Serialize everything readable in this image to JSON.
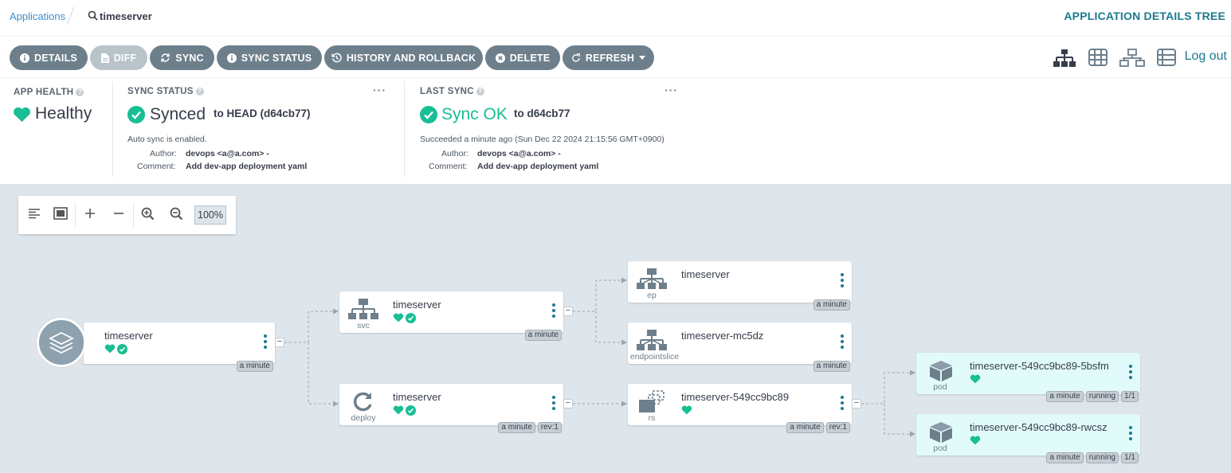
{
  "breadcrumb": {
    "applications_label": "Applications",
    "current": "timeserver"
  },
  "page_title": "APPLICATION DETAILS TREE",
  "toolbar": {
    "details": "DETAILS",
    "diff": "DIFF",
    "sync": "SYNC",
    "sync_status": "SYNC STATUS",
    "history": "HISTORY AND ROLLBACK",
    "delete": "DELETE",
    "refresh": "REFRESH",
    "logout": "Log out"
  },
  "app_health": {
    "label": "APP HEALTH",
    "value": "Healthy"
  },
  "sync_status": {
    "label": "SYNC STATUS",
    "value": "Synced",
    "target": "to HEAD (d64cb77)",
    "auto_sync": "Auto sync is enabled.",
    "author_label": "Author:",
    "author": "devops <a@a.com> -",
    "comment_label": "Comment:",
    "comment": "Add dev-app deployment yaml"
  },
  "last_sync": {
    "label": "LAST SYNC",
    "value": "Sync OK",
    "target": "to d64cb77",
    "succeeded": "Succeeded a minute ago (Sun Dec 22 2024 21:15:56 GMT+0900)",
    "author_label": "Author:",
    "author": "devops <a@a.com> -",
    "comment_label": "Comment:",
    "comment": "Add dev-app deployment yaml"
  },
  "zoom": {
    "value": "100%"
  },
  "colors": {
    "healthy": "#18be94",
    "accent": "#1b7a8f",
    "button": "#6d7f8b"
  },
  "nodes": {
    "app": {
      "name": "timeserver",
      "age": "a minute"
    },
    "svc": {
      "name": "timeserver",
      "kind": "svc",
      "age": "a minute"
    },
    "deploy": {
      "name": "timeserver",
      "kind": "deploy",
      "age": "a minute",
      "rev": "rev:1"
    },
    "ep": {
      "name": "timeserver",
      "kind": "ep",
      "age": "a minute"
    },
    "endpointslice": {
      "name": "timeserver-mc5dz",
      "kind": "endpointslice",
      "age": "a minute"
    },
    "rs": {
      "name": "timeserver-549cc9bc89",
      "kind": "rs",
      "age": "a minute",
      "rev": "rev:1"
    },
    "pod1": {
      "name": "timeserver-549cc9bc89-5bsfm",
      "kind": "pod",
      "age": "a minute",
      "state": "running",
      "ready": "1/1"
    },
    "pod2": {
      "name": "timeserver-549cc9bc89-rwcsz",
      "kind": "pod",
      "age": "a minute",
      "state": "running",
      "ready": "1/1"
    }
  }
}
